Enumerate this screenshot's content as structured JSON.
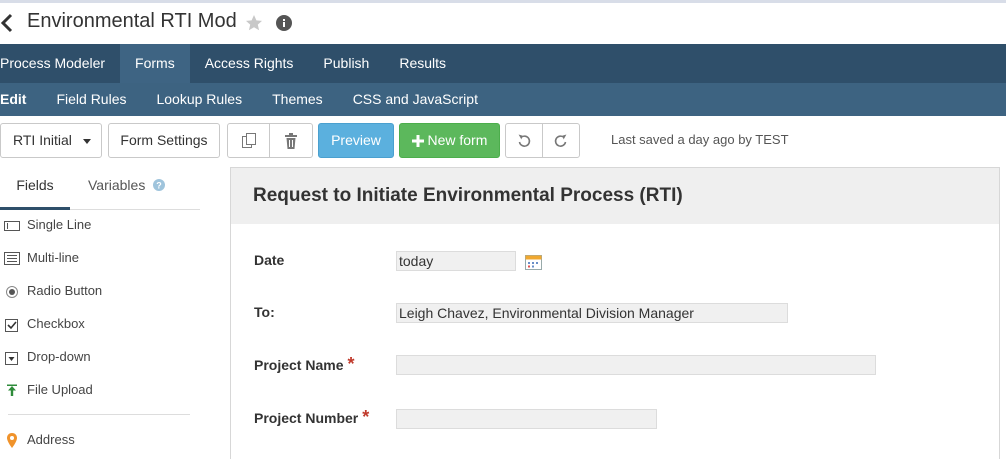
{
  "header": {
    "title": "Environmental RTI Mod"
  },
  "main_nav": {
    "items": [
      "Process Modeler",
      "Forms",
      "Access Rights",
      "Publish",
      "Results"
    ],
    "active": "Forms"
  },
  "sub_nav": {
    "items": [
      "Edit",
      "Field Rules",
      "Lookup Rules",
      "Themes",
      "CSS and JavaScript"
    ],
    "active": "Edit"
  },
  "toolbar": {
    "form_select_label": "RTI Initial",
    "settings_label": "Form Settings",
    "preview_label": "Preview",
    "new_form_label": "New form",
    "last_saved": "Last saved a day ago by TEST"
  },
  "sidebar": {
    "tabs": [
      "Fields",
      "Variables"
    ],
    "active_tab": "Fields",
    "fields": [
      {
        "label": "Single Line",
        "icon": "single-line-icon"
      },
      {
        "label": "Multi-line",
        "icon": "multi-line-icon"
      },
      {
        "label": "Radio Button",
        "icon": "radio-button-icon"
      },
      {
        "label": "Checkbox",
        "icon": "checkbox-icon"
      },
      {
        "label": "Drop-down",
        "icon": "dropdown-icon"
      },
      {
        "label": "File Upload",
        "icon": "file-upload-icon"
      },
      {
        "label": "Address",
        "icon": "map-pin-icon"
      }
    ]
  },
  "form": {
    "title": "Request to Initiate Environmental Process (RTI)",
    "fields": [
      {
        "label": "Date",
        "value": "today",
        "required": false
      },
      {
        "label": "To:",
        "value": "Leigh Chavez, Environmental Division Manager",
        "required": false
      },
      {
        "label": "Project Name",
        "value": "",
        "required": true
      },
      {
        "label": "Project Number",
        "value": "",
        "required": true
      }
    ],
    "required_mark": "*"
  },
  "colors": {
    "nav_bg": "#2f4f6a",
    "subnav_bg": "#3d6381",
    "preview_btn": "#5bb0de",
    "new_form_btn": "#5cb85c",
    "required": "#c0392b"
  }
}
